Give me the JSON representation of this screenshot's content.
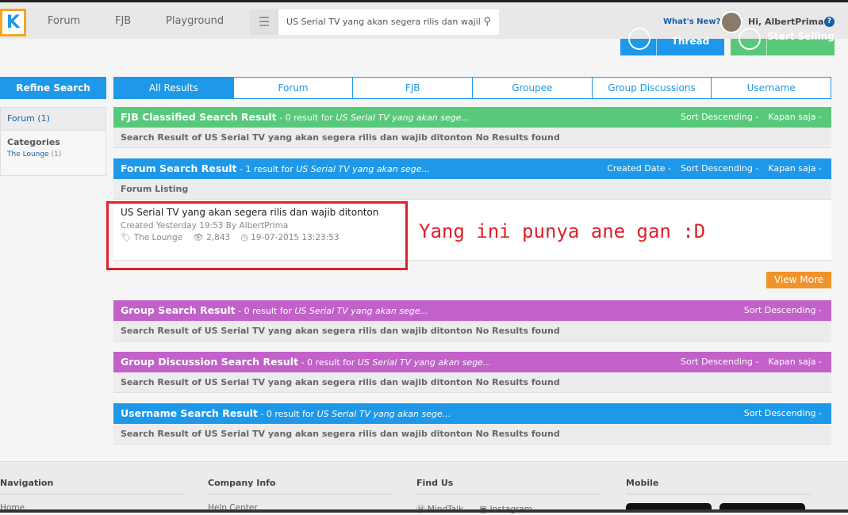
{
  "header": {
    "logo": "K",
    "nav": [
      "Forum",
      "FJB",
      "Playground"
    ],
    "search_value": "US Serial TV yang akan segera rilis dan wajil",
    "whats_new": "What's New?",
    "greeting": "Hi, AlbertPrima",
    "help": "?",
    "cta": [
      {
        "label": "Thread",
        "color": "#1e98e8"
      },
      {
        "label": "Start Selling",
        "color": "#58c97a"
      }
    ]
  },
  "sidebar": {
    "title": "Refine Search",
    "forum": "Forum (1)",
    "categories_label": "Categories",
    "category": "The Lounge",
    "category_count": "(1)"
  },
  "tabs": [
    "All Results",
    "Forum",
    "FJB",
    "Groupee",
    "Group Discussions",
    "Username"
  ],
  "sections": [
    {
      "title": "FJB Classified Search Result",
      "summary": " - 0 result for ",
      "query": "US Serial TV yang akan sege...",
      "controls": [
        "Sort Descending -",
        "Kapan saja -"
      ],
      "sub": "Search Result of US Serial TV yang akan segera rilis dan wajib ditonton No Results found",
      "color": "#58c97a"
    },
    {
      "title": "Forum Search Result",
      "summary": " - 1 result for ",
      "query": "US Serial TV yang akan sege...",
      "controls": [
        "Created Date -",
        "Sort Descending -",
        "Kapan saja -"
      ],
      "sub": "Forum Listing",
      "color": "#1e98e8"
    },
    {
      "title": "Group Search Result",
      "summary": " - 0 result for ",
      "query": "US Serial TV yang akan sege...",
      "controls": [
        "Sort Descending -"
      ],
      "sub": "Search Result of US Serial TV yang akan segera rilis dan wajib ditonton No Results found",
      "color": "#c161c9"
    },
    {
      "title": "Group Discussion Search Result",
      "summary": " - 0 result for ",
      "query": "US Serial TV yang akan sege...",
      "controls": [
        "Sort Descending -",
        "Kapan saja -"
      ],
      "sub": "Search Result of US Serial TV yang akan segera rilis dan wajib ditonton No Results found",
      "color": "#c161c9"
    },
    {
      "title": "Username Search Result",
      "summary": " - 0 result for ",
      "query": "US Serial TV yang akan sege...",
      "controls": [
        "Sort Descending -"
      ],
      "sub": "Search Result of US Serial TV yang akan segera rilis dan wajib ditonton No Results found",
      "color": "#1e98e8"
    }
  ],
  "result": {
    "title": "US Serial TV yang akan segera rilis dan wajib ditonton",
    "created": "Created Yesterday 19:53 By AlbertPrima",
    "category": "The Lounge",
    "views": "2,843",
    "date": "19-07-2015 13:23:53"
  },
  "annotation": "Yang ini punya ane gan :D",
  "view_more": "View More",
  "footer": {
    "cols": [
      {
        "title": "Navigation",
        "item": "Home"
      },
      {
        "title": "Company Info",
        "item": "Help Center"
      },
      {
        "title": "Find Us",
        "items": [
          "MindTalk",
          "Instagram"
        ]
      },
      {
        "title": "Mobile"
      }
    ]
  }
}
